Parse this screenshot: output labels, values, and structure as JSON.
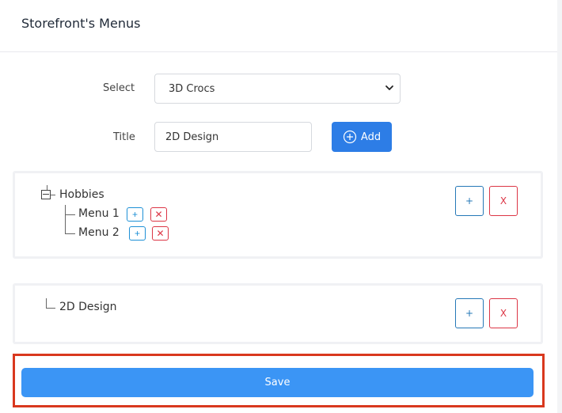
{
  "header": {
    "title": "Storefront's Menus"
  },
  "form": {
    "select_label": "Select",
    "select_value": "3D Crocs",
    "title_label": "Title",
    "title_value": "2D Design",
    "add_label": "Add"
  },
  "menus": [
    {
      "name": "Hobbies",
      "children": [
        {
          "name": "Menu 1"
        },
        {
          "name": "Menu 2"
        }
      ]
    },
    {
      "name": "2D Design",
      "children": []
    }
  ],
  "buttons": {
    "plus": "+",
    "remove": "X",
    "mini_remove": "✕"
  },
  "save_label": "Save",
  "colors": {
    "primary": "#2d7de6",
    "save": "#3b95f5",
    "danger": "#dc3545",
    "highlight": "#d9381e"
  },
  "icons": {
    "add": "plus-circle-icon",
    "select": "chevron-down-icon"
  }
}
